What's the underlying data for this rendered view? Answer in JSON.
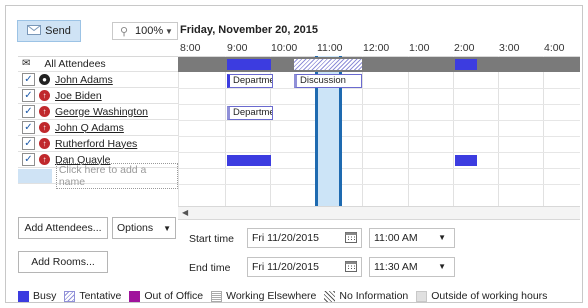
{
  "toolbar": {
    "send_label": "Send",
    "zoom_value": "100%"
  },
  "schedule": {
    "date_title": "Friday, November 20, 2015",
    "hours": [
      "8:00",
      "9:00",
      "10:00",
      "11:00",
      "12:00",
      "1:00",
      "2:00",
      "3:00",
      "4:00"
    ]
  },
  "attendees": {
    "header": "All Attendees",
    "list": [
      {
        "name": "John Adams",
        "role": "organizer",
        "checked": true
      },
      {
        "name": "Joe Biden",
        "role": "required",
        "checked": true
      },
      {
        "name": "George Washington",
        "role": "required",
        "checked": true
      },
      {
        "name": "John Q Adams",
        "role": "required",
        "checked": true
      },
      {
        "name": "Rutherford Hayes",
        "role": "required",
        "checked": true
      },
      {
        "name": "Dan Quayle",
        "role": "required",
        "checked": true
      }
    ],
    "add_placeholder": "Click here to add a name"
  },
  "appointments": {
    "department_label": "Departme",
    "discussion_label": "Discussion"
  },
  "buttons": {
    "add_attendees": "Add Attendees...",
    "options": "Options",
    "add_rooms": "Add Rooms..."
  },
  "times": {
    "start_label": "Start time",
    "start_date": "Fri 11/20/2015",
    "start_time": "11:00 AM",
    "end_label": "End time",
    "end_date": "Fri 11/20/2015",
    "end_time": "11:30 AM"
  },
  "legend": {
    "busy": "Busy",
    "tentative": "Tentative",
    "out_of_office": "Out of Office",
    "working_elsewhere": "Working Elsewhere",
    "no_information": "No Information",
    "outside_hours": "Outside of working hours"
  },
  "colors": {
    "busy": "#3c3ce0",
    "out_of_office": "#a0139c",
    "selection": "#1e6ab0"
  }
}
